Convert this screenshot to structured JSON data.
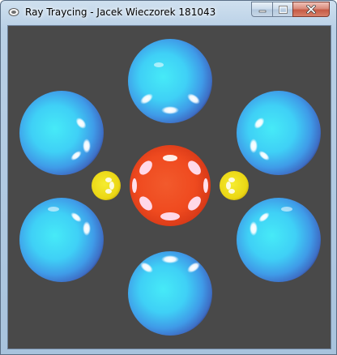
{
  "window": {
    "title": "Ray Traycing - Jacek Wieczorek 181043",
    "controls": {
      "minimize_icon": "minimize-icon",
      "maximize_icon": "maximize-icon",
      "close_icon": "close-icon"
    }
  },
  "canvas": {
    "background": "#494949",
    "colors": {
      "blue_sphere": "#3fb8ef",
      "red_sphere": "#f04a20",
      "yellow_sphere": "#f2e21a"
    }
  }
}
